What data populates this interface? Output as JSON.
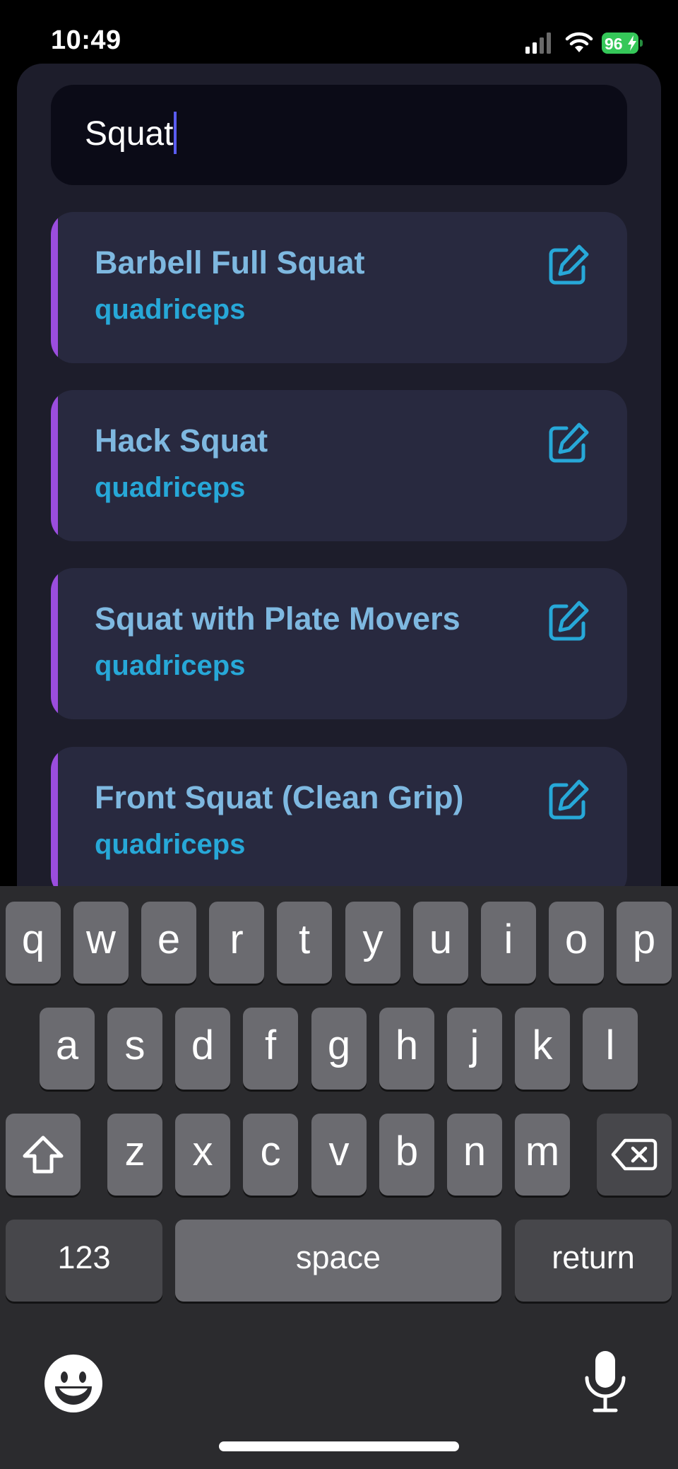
{
  "status_bar": {
    "time": "10:49",
    "battery": "96"
  },
  "search": {
    "value": "Squat"
  },
  "exercises": [
    {
      "name": "Barbell Full Squat",
      "muscle": "quadriceps"
    },
    {
      "name": "Hack Squat",
      "muscle": "quadriceps"
    },
    {
      "name": "Squat with Plate Movers",
      "muscle": "quadriceps"
    },
    {
      "name": "Front Squat (Clean Grip)",
      "muscle": "quadriceps"
    }
  ],
  "keyboard": {
    "row1": [
      "q",
      "w",
      "e",
      "r",
      "t",
      "y",
      "u",
      "i",
      "o",
      "p"
    ],
    "row2": [
      "a",
      "s",
      "d",
      "f",
      "g",
      "h",
      "j",
      "k",
      "l"
    ],
    "row3": [
      "z",
      "x",
      "c",
      "v",
      "b",
      "n",
      "m"
    ],
    "numbers_label": "123",
    "space_label": "space",
    "return_label": "return"
  },
  "icons": {
    "edit": "edit-icon",
    "shift": "shift-icon",
    "delete": "backspace-icon",
    "emoji": "emoji-icon",
    "mic": "microphone-icon"
  },
  "colors": {
    "accent": "#9b4dde",
    "title": "#7eb8e0",
    "subtitle": "#27a8d8",
    "card": "#28293f",
    "panel": "#1d1d2b"
  }
}
